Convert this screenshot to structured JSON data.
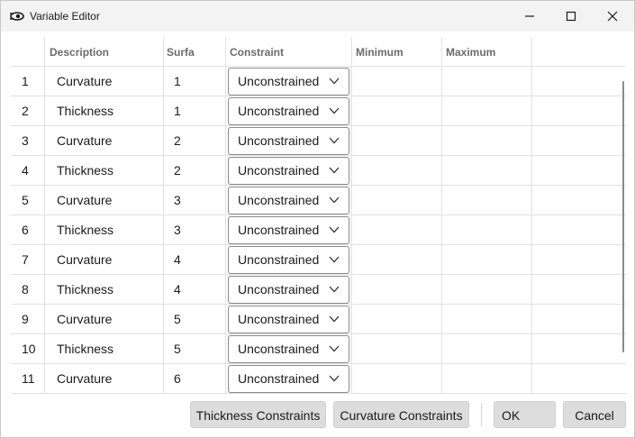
{
  "window": {
    "title": "Variable Editor",
    "icon": "eye-lens-icon"
  },
  "columns": {
    "number": "",
    "description": "Description",
    "surface": "Surfa",
    "constraint": "Constraint",
    "minimum": "Minimum",
    "maximum": "Maximum"
  },
  "rows": [
    {
      "number": "1",
      "description": "Curvature",
      "surface": "1",
      "constraint": "Unconstrained",
      "minimum": "",
      "maximum": ""
    },
    {
      "number": "2",
      "description": "Thickness",
      "surface": "1",
      "constraint": "Unconstrained",
      "minimum": "",
      "maximum": ""
    },
    {
      "number": "3",
      "description": "Curvature",
      "surface": "2",
      "constraint": "Unconstrained",
      "minimum": "",
      "maximum": ""
    },
    {
      "number": "4",
      "description": "Thickness",
      "surface": "2",
      "constraint": "Unconstrained",
      "minimum": "",
      "maximum": ""
    },
    {
      "number": "5",
      "description": "Curvature",
      "surface": "3",
      "constraint": "Unconstrained",
      "minimum": "",
      "maximum": ""
    },
    {
      "number": "6",
      "description": "Thickness",
      "surface": "3",
      "constraint": "Unconstrained",
      "minimum": "",
      "maximum": ""
    },
    {
      "number": "7",
      "description": "Curvature",
      "surface": "4",
      "constraint": "Unconstrained",
      "minimum": "",
      "maximum": ""
    },
    {
      "number": "8",
      "description": "Thickness",
      "surface": "4",
      "constraint": "Unconstrained",
      "minimum": "",
      "maximum": ""
    },
    {
      "number": "9",
      "description": "Curvature",
      "surface": "5",
      "constraint": "Unconstrained",
      "minimum": "",
      "maximum": ""
    },
    {
      "number": "10",
      "description": "Thickness",
      "surface": "5",
      "constraint": "Unconstrained",
      "minimum": "",
      "maximum": ""
    },
    {
      "number": "11",
      "description": "Curvature",
      "surface": "6",
      "constraint": "Unconstrained",
      "minimum": "",
      "maximum": ""
    }
  ],
  "buttons": {
    "thickness_constraints": "Thickness Constraints",
    "curvature_constraints": "Curvature Constraints",
    "ok": "OK",
    "cancel": "Cancel"
  }
}
